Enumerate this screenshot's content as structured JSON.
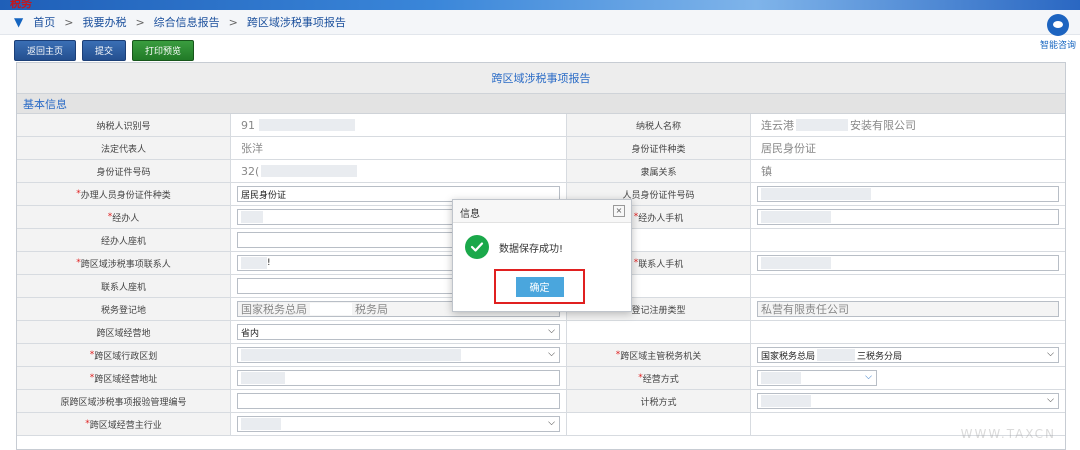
{
  "header": {
    "brand": "税务",
    "breadcrumb": [
      "首页",
      "我要办税",
      "综合信息报告",
      "跨区域涉税事项报告"
    ],
    "breadcrumb_sep": ">",
    "helper_label": "智能咨询"
  },
  "toolbar": {
    "back_label": "返回主页",
    "submit_label": "提交",
    "print_label": "打印预览"
  },
  "form": {
    "title": "跨区域涉税事项报告",
    "section": "基本信息",
    "rows": [
      {
        "l1": "纳税人识别号",
        "r1": "",
        "v1": "91",
        "l2": "纳税人名称",
        "r2": "",
        "v2a": "连云港",
        "v2b": "安装有限公司"
      },
      {
        "l1": "法定代表人",
        "r1": "",
        "v1": "张洋",
        "l2": "身份证件种类",
        "r2": "",
        "v2a": "居民身份证",
        "v2b": ""
      },
      {
        "l1": "身份证件号码",
        "r1": "",
        "v1": "32(",
        "l2": "隶属关系",
        "r2": "",
        "v2a": "镇",
        "v2b": ""
      },
      {
        "l1": "办理人员身份证件种类",
        "r1": "*",
        "v1": "居民身份证",
        "l2": "人员身份证件号码",
        "r2": "",
        "v2a": "",
        "v2b": ""
      },
      {
        "l1": "经办人",
        "r1": "*",
        "v1": "",
        "l2": "经办人手机",
        "r2": "*",
        "v2a": "",
        "v2b": ""
      },
      {
        "l1": "经办人座机",
        "r1": "",
        "v1": "",
        "l2": "",
        "r2": "",
        "v2a": "",
        "v2b": ""
      },
      {
        "l1": "跨区域涉税事项联系人",
        "r1": "*",
        "v1": "!",
        "l2": "联系人手机",
        "r2": "*",
        "v2a": "",
        "v2b": ""
      },
      {
        "l1": "联系人座机",
        "r1": "",
        "v1": "",
        "l2": "",
        "r2": "",
        "v2a": "",
        "v2b": ""
      },
      {
        "l1": "税务登记地",
        "r1": "",
        "v1": "国家税务总局",
        "v1b": "税务局",
        "l2": "登记注册类型",
        "r2": "",
        "v2a": "私营有限责任公司",
        "v2b": ""
      },
      {
        "l1": "跨区域经营地",
        "r1": "",
        "v1": "省内",
        "l2": "",
        "r2": "",
        "v2a": "",
        "v2b": ""
      },
      {
        "l1": "跨区域行政区划",
        "r1": "*",
        "v1": "",
        "l2": "跨区域主管税务机关",
        "r2": "*",
        "v2a": "国家税务总局",
        "v2b": "三税务分局"
      },
      {
        "l1": "跨区域经营地址",
        "r1": "*",
        "v1": "",
        "l2": "经营方式",
        "r2": "*",
        "v2a": "",
        "v2b": ""
      },
      {
        "l1": "原跨区域涉税事项报验管理编号",
        "r1": "",
        "v1": "",
        "l2": "计税方式",
        "r2": "",
        "v2a": "",
        "v2b": ""
      },
      {
        "l1": "跨区域经营主行业",
        "r1": "*",
        "v1": "",
        "l2": "",
        "r2": "",
        "v2a": "",
        "v2b": ""
      }
    ]
  },
  "dialog": {
    "title": "信息",
    "close_label": "×",
    "message": "数据保存成功!",
    "confirm_label": "确定",
    "status": "success"
  },
  "watermark": "WWW.TAXCN",
  "colors": {
    "accent": "#2a6bc6",
    "button": "#244f8f",
    "success": "#1aa84a",
    "highlight": "#e02020"
  }
}
